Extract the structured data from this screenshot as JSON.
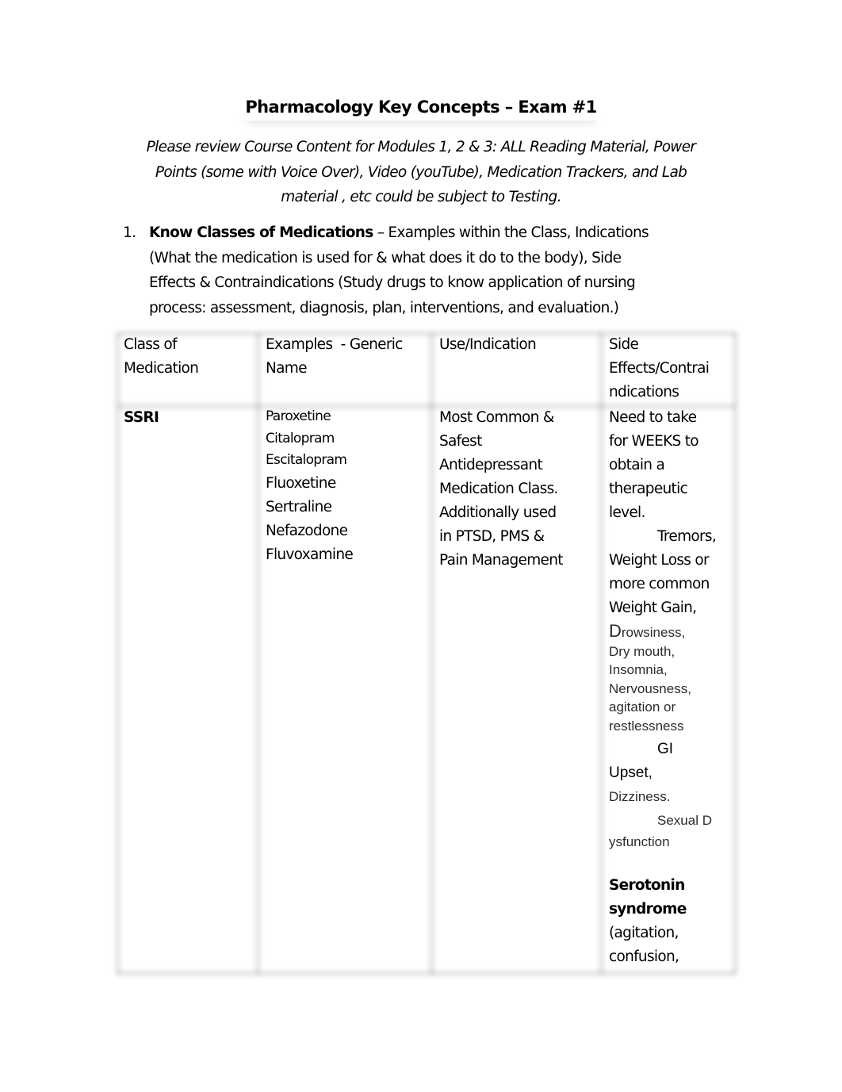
{
  "document": {
    "title": "Pharmacology Key Concepts – Exam #1",
    "intro_lines": [
      "Please review Course Content for Modules 1, 2 & 3: ALL Reading Material, Power",
      "Points (some with Voice Over), Video (youTube), Medication Trackers, and Lab",
      "material , etc could be subject to Testing."
    ],
    "list_items": [
      {
        "number": "1.",
        "bold_lead": "Know Classes of Medications",
        "lines": [
          " – Examples within the Class, Indications",
          "(What the medication is used for & what does it do to the body), Side",
          "Effects & Contraindications (Study drugs to know application of nursing",
          "process: assessment, diagnosis, plan, interventions, and evaluation.)"
        ]
      }
    ]
  },
  "table": {
    "headers": [
      [
        "Class of",
        "Medication"
      ],
      [
        "Examples  - Generic",
        "Name"
      ],
      [
        "Use/Indication"
      ],
      [
        "Side",
        "Effects/Contrai",
        "ndications"
      ]
    ],
    "rows": [
      {
        "class": "SSRI",
        "examples_small": [
          "Paroxetine",
          "Citalopram",
          "Escitalopram"
        ],
        "examples_large": [
          "Fluoxetine",
          "Sertraline",
          "Nefazodone",
          "Fluvoxamine"
        ],
        "use_lines": [
          "Most Common &",
          "Safest",
          "Antidepressant",
          "Medication Class.",
          "Additionally used",
          "in PTSD, PMS &",
          "Pain Management"
        ],
        "side_effects": {
          "lines_a": [
            "Need to take",
            "for WEEKS to",
            "obtain a",
            "therapeutic",
            "level."
          ],
          "tremors": "Tremors,",
          "lines_b": [
            "Weight Loss or",
            "more common",
            "Weight Gain,"
          ],
          "drowsiness_initial": "D",
          "drowsiness_rest": "rowsiness,",
          "lines_c": [
            "Dry mouth,",
            "Insomnia,",
            "Nervousness,",
            "agitation or",
            "restlessness"
          ],
          "gi": "GI",
          "upset": "Upset,",
          "dizziness": "Dizziness.",
          "sexual_a": "Sexual D",
          "sexual_b": "ysfunction",
          "serotonin_bold": [
            "Serotonin",
            "syndrome"
          ],
          "lines_d": [
            "(agitation,",
            "confusion,"
          ]
        }
      }
    ]
  }
}
